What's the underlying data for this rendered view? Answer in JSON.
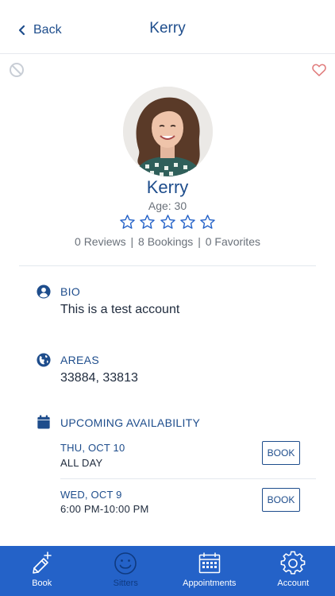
{
  "nav": {
    "back_label": "Back",
    "title": "Kerry"
  },
  "profile": {
    "name": "Kerry",
    "age": "Age: 30",
    "rating": 0,
    "rating_max": 5,
    "reviews": "0 Reviews",
    "bookings": "8 Bookings",
    "favorites": "0 Favorites",
    "separator": "|"
  },
  "bio": {
    "title": "BIO",
    "text": "This is a test account"
  },
  "areas": {
    "title": "AREAS",
    "text": "33884, 33813"
  },
  "availability": {
    "title": "UPCOMING AVAILABILITY",
    "slots": [
      {
        "date": "THU, OCT 10",
        "time": "ALL DAY",
        "button": "BOOK"
      },
      {
        "date": "WED, OCT 9",
        "time": "6:00 PM-10:00 PM",
        "button": "BOOK"
      }
    ]
  },
  "tabbar": {
    "tabs": [
      {
        "label": "Book",
        "icon": "pencil-plus-icon"
      },
      {
        "label": "Sitters",
        "icon": "smiley-icon"
      },
      {
        "label": "Appointments",
        "icon": "calendar-icon"
      },
      {
        "label": "Account",
        "icon": "gear-icon"
      }
    ]
  },
  "colors": {
    "primary": "#1e4d8c",
    "tabbar": "#2462c8",
    "heart": "#e07a7a",
    "muted": "#6a717a"
  }
}
